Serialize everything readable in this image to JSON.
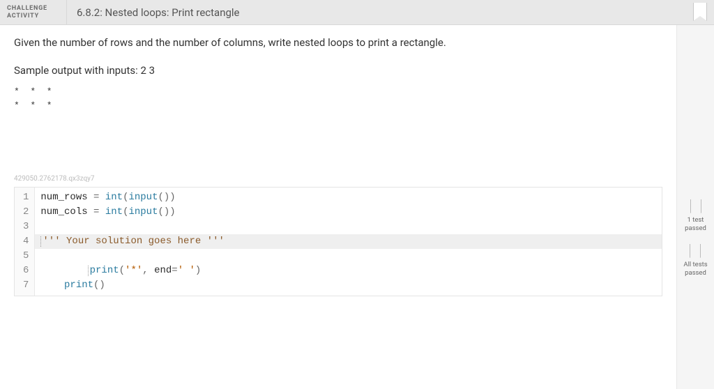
{
  "header": {
    "label_line1": "CHALLENGE",
    "label_line2": "ACTIVITY",
    "title": "6.8.2: Nested loops: Print rectangle"
  },
  "instruction": "Given the number of rows and the number of columns, write nested loops to print a rectangle.",
  "sample_label": "Sample output with inputs: 2 3",
  "sample_output": "*  *  *\n*  *  *",
  "tiny_id": "429050.2762178.qx3zqy7",
  "status": {
    "item1_line1": "1 test",
    "item1_line2": "passed",
    "item2_line1": "All tests",
    "item2_line2": "passed"
  },
  "code": {
    "line_numbers": [
      "1",
      "2",
      "3",
      "4",
      "5",
      "6",
      "7"
    ],
    "l1": {
      "a": "num_rows",
      "b": " = ",
      "c": "int",
      "d": "(",
      "e": "input",
      "f": "())"
    },
    "l2": {
      "a": "num_cols",
      "b": " = ",
      "c": "int",
      "d": "(",
      "e": "input",
      "f": "())"
    },
    "l4": {
      "q1": "'''",
      "txt": " Your solution goes here ",
      "q2": "'''"
    },
    "l6": {
      "indent": "        ",
      "p": "print",
      "open": "(",
      "s": "'*'",
      "comma": ", ",
      "kw": "end",
      "eq": "=",
      "s2": "' '",
      "close": ")"
    },
    "l7": {
      "indent": "    ",
      "p": "print",
      "paren": "()"
    }
  }
}
